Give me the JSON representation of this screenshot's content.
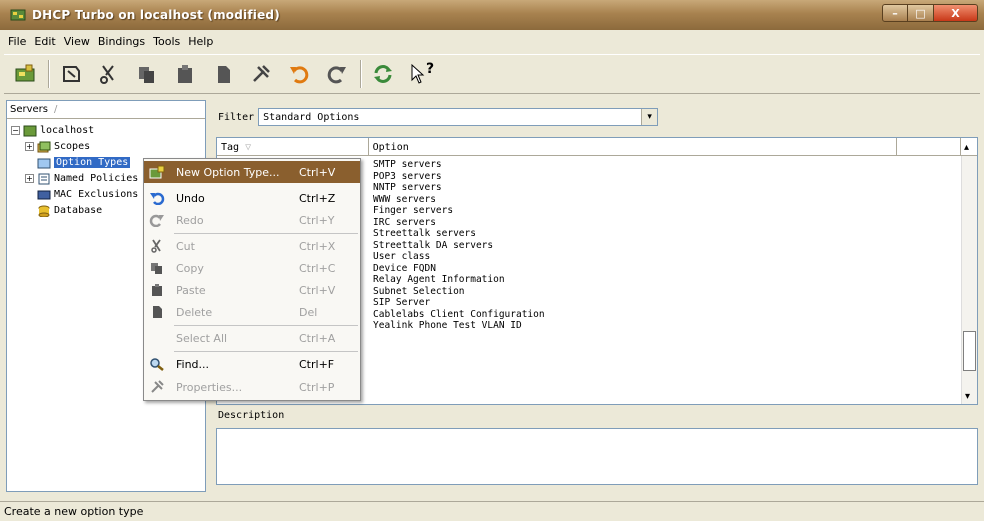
{
  "window": {
    "title": "DHCP Turbo on localhost (modified)",
    "min_glyph": "–",
    "max_glyph": "□",
    "close_glyph": "X"
  },
  "menubar": [
    {
      "label": "File",
      "key": "F"
    },
    {
      "label": "Edit",
      "key": "E"
    },
    {
      "label": "View",
      "key": "V"
    },
    {
      "label": "Bindings",
      "key": "B"
    },
    {
      "label": "Tools",
      "key": "T"
    },
    {
      "label": "Help",
      "key": "H"
    }
  ],
  "toolbar": {
    "buttons": [
      "new-server-icon",
      "open-icon",
      "cut-icon",
      "copy-icon",
      "paste-icon",
      "delete-icon",
      "properties-icon",
      "undo-icon",
      "redo-icon",
      "refresh-icon",
      "help-pointer-icon"
    ],
    "help_glyph": "?"
  },
  "tree": {
    "header": "Servers",
    "header_sep": "/",
    "items": [
      {
        "label": "localhost",
        "expander": "−"
      },
      {
        "label": "Scopes",
        "expander": "+"
      },
      {
        "label": "Option Types"
      },
      {
        "label": "Named Policies",
        "expander": "+"
      },
      {
        "label": "MAC Exclusions"
      },
      {
        "label": "Database"
      }
    ]
  },
  "filter": {
    "label": "Filter",
    "value": "Standard Options",
    "arrow_glyph": "▾"
  },
  "table": {
    "columns": [
      "Tag",
      "Option"
    ],
    "sort_glyph": "▽",
    "rows": [
      "SMTP servers",
      "POP3 servers",
      "NNTP servers",
      "WWW servers",
      "Finger servers",
      "IRC servers",
      "Streettalk servers",
      "Streettalk DA servers",
      "User class",
      "Device FQDN",
      "Relay Agent Information",
      "Subnet Selection",
      "SIP Server",
      "Cablelabs Client Configuration",
      "Yealink Phone Test VLAN ID"
    ],
    "scroll_up_glyph": "▴",
    "scroll_down_glyph": "▾"
  },
  "description": {
    "label": "Description"
  },
  "status": {
    "text": "Create a new option type"
  },
  "context_menu": {
    "items": [
      {
        "label": "New Option Type...",
        "shortcut": "Ctrl+V",
        "state": "highlighted",
        "icon": "new-option-icon"
      },
      {
        "label": "Undo",
        "shortcut": "Ctrl+Z",
        "state": "enabled",
        "icon": "undo-icon"
      },
      {
        "label": "Redo",
        "shortcut": "Ctrl+Y",
        "state": "disabled",
        "icon": "redo-icon"
      },
      {
        "label": "Cut",
        "shortcut": "Ctrl+X",
        "state": "disabled",
        "icon": "cut-icon"
      },
      {
        "label": "Copy",
        "shortcut": "Ctrl+C",
        "state": "disabled",
        "icon": "copy-icon"
      },
      {
        "label": "Paste",
        "shortcut": "Ctrl+V",
        "state": "disabled",
        "icon": "paste-icon"
      },
      {
        "label": "Delete",
        "shortcut": "Del",
        "state": "disabled",
        "icon": "delete-icon"
      },
      {
        "label": "Select All",
        "shortcut": "Ctrl+A",
        "state": "disabled",
        "icon": ""
      },
      {
        "label": "Find...",
        "shortcut": "Ctrl+F",
        "state": "enabled",
        "icon": "find-icon"
      },
      {
        "label": "Properties...",
        "shortcut": "Ctrl+P",
        "state": "disabled",
        "icon": "properties-icon"
      }
    ]
  },
  "colors": {
    "title_bar": "#a8824f",
    "menu_highlight": "#8a5f2e",
    "tree_selection": "#316ac5"
  }
}
